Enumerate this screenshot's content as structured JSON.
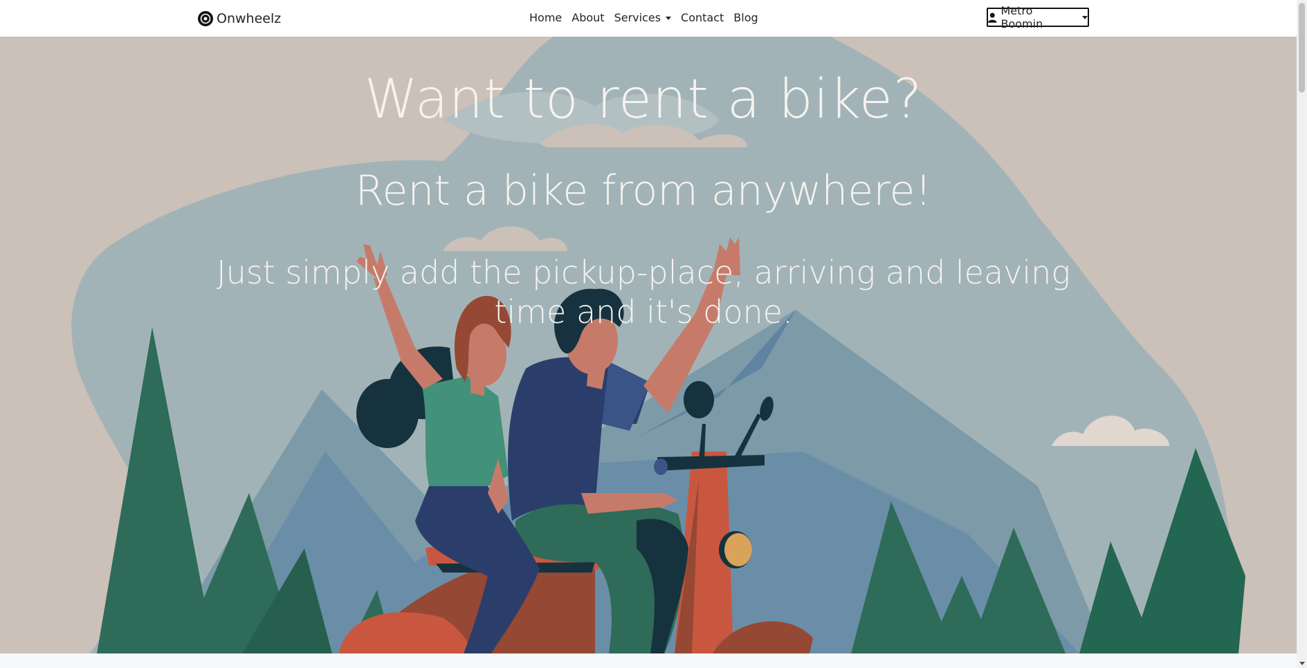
{
  "navbar": {
    "brand": "Onwheelz",
    "links": [
      {
        "label": "Home"
      },
      {
        "label": "About"
      },
      {
        "label": "Services",
        "dropdown": true
      },
      {
        "label": "Contact"
      },
      {
        "label": "Blog"
      }
    ],
    "user_menu_label": "Metro Boomin"
  },
  "hero": {
    "heading": "Want to rent a bike?",
    "subheading": "Rent a bike from anywhere!",
    "description": "Just simply add the pickup-place, arriving and leaving time and it's done."
  },
  "icons": {
    "brand": "wheel-icon",
    "user": "person-icon",
    "dropdown": "caret-down-icon"
  },
  "colors": {
    "hero_background": "#cbc1b8",
    "hero_text": "#f6f3f0",
    "navbar_background": "#ffffff"
  }
}
